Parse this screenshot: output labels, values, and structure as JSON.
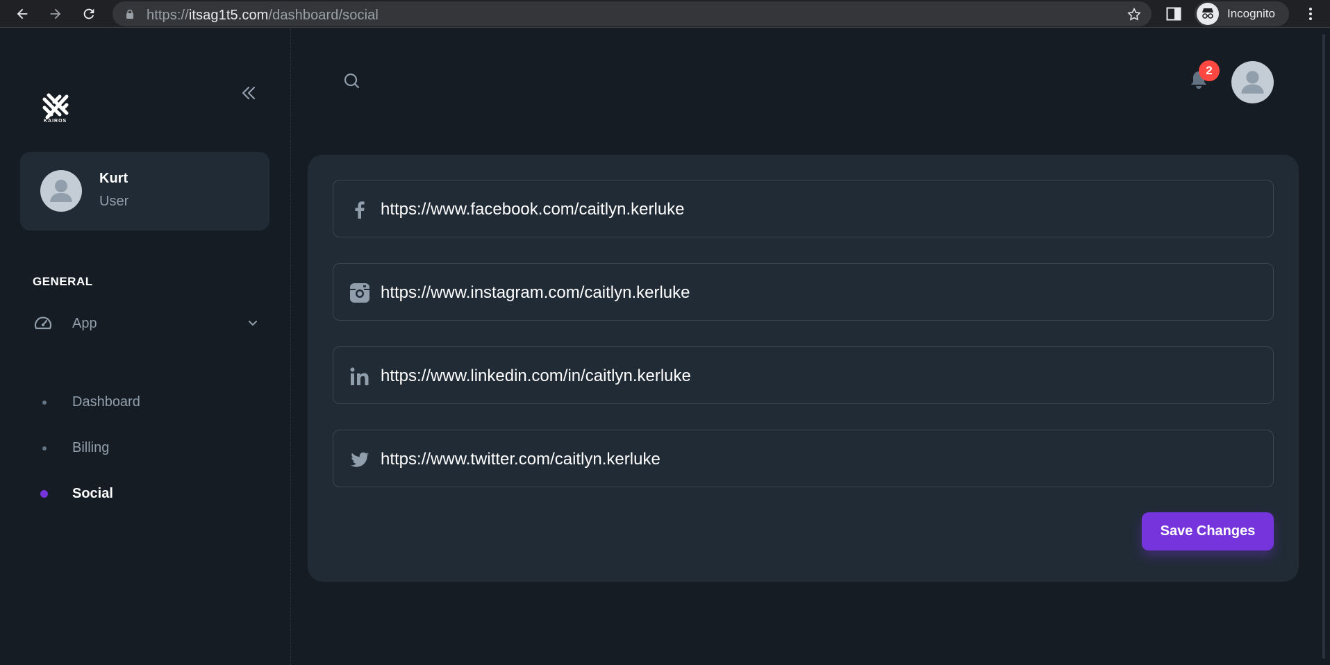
{
  "browser": {
    "url_scheme": "https://",
    "url_host": "itsag1t5.com",
    "url_path": "/dashboard/social",
    "incognito_label": "Incognito"
  },
  "sidebar": {
    "logo_text": "KAIROS",
    "user": {
      "name": "Kurt",
      "role": "User"
    },
    "section_title": "GENERAL",
    "app_label": "App",
    "items": [
      {
        "label": "Dashboard"
      },
      {
        "label": "Billing"
      },
      {
        "label": "Social"
      }
    ]
  },
  "header": {
    "notification_count": "2"
  },
  "social": {
    "fields": [
      {
        "icon": "facebook-icon",
        "value": "https://www.facebook.com/caitlyn.kerluke"
      },
      {
        "icon": "instagram-icon",
        "value": "https://www.instagram.com/caitlyn.kerluke"
      },
      {
        "icon": "linkedin-icon",
        "value": "https://www.linkedin.com/in/caitlyn.kerluke"
      },
      {
        "icon": "twitter-icon",
        "value": "https://www.twitter.com/caitlyn.kerluke"
      }
    ],
    "save_label": "Save Changes"
  },
  "colors": {
    "background": "#161c24",
    "card": "#212b36",
    "accent": "#7635dc",
    "badge": "#ff4842"
  }
}
